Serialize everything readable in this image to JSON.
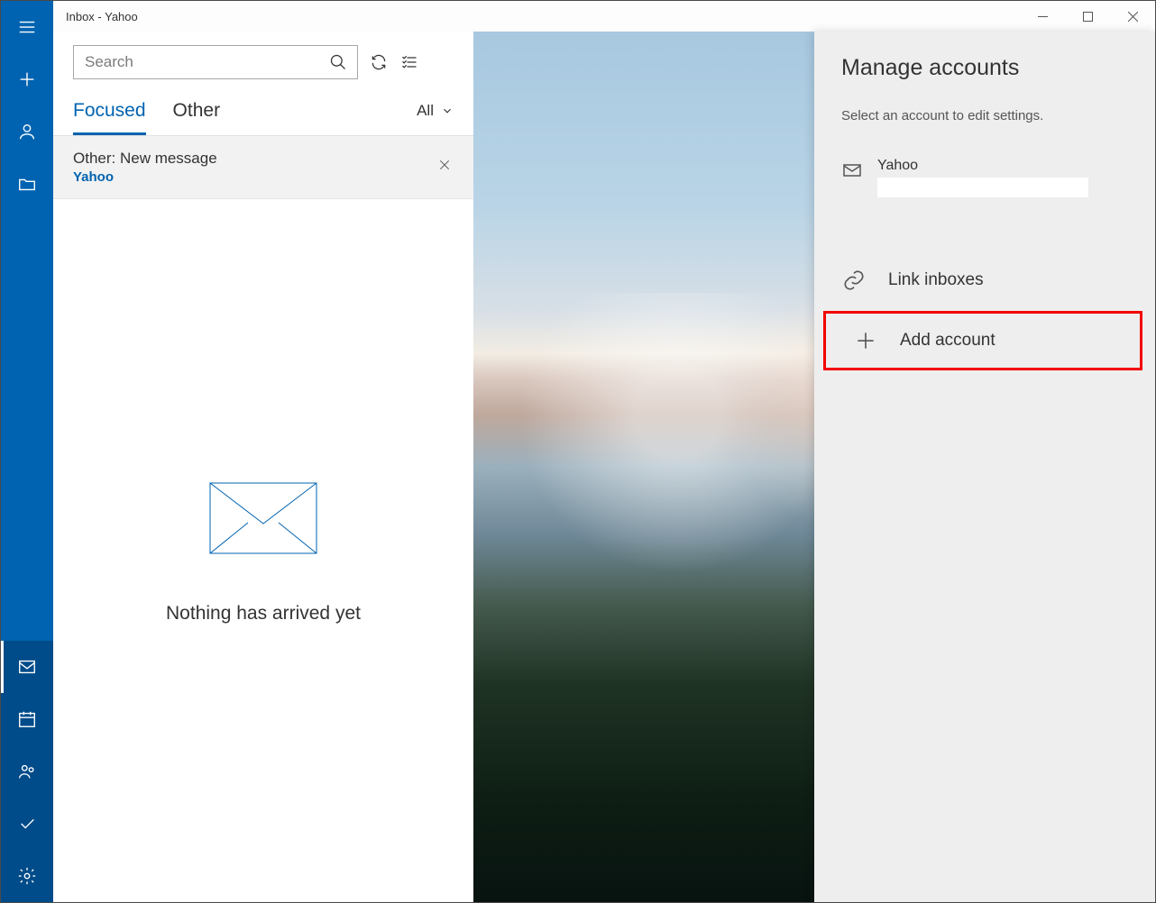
{
  "window": {
    "title": "Inbox - Yahoo"
  },
  "search": {
    "placeholder": "Search"
  },
  "tabs": {
    "focused": "Focused",
    "other": "Other",
    "filter": "All"
  },
  "notification": {
    "title": "Other: New message",
    "source": "Yahoo"
  },
  "empty": {
    "message": "Nothing has arrived yet"
  },
  "flyout": {
    "title": "Manage accounts",
    "subtitle": "Select an account to edit settings.",
    "account": {
      "name": "Yahoo"
    },
    "link_inboxes": "Link inboxes",
    "add_account": "Add account"
  }
}
